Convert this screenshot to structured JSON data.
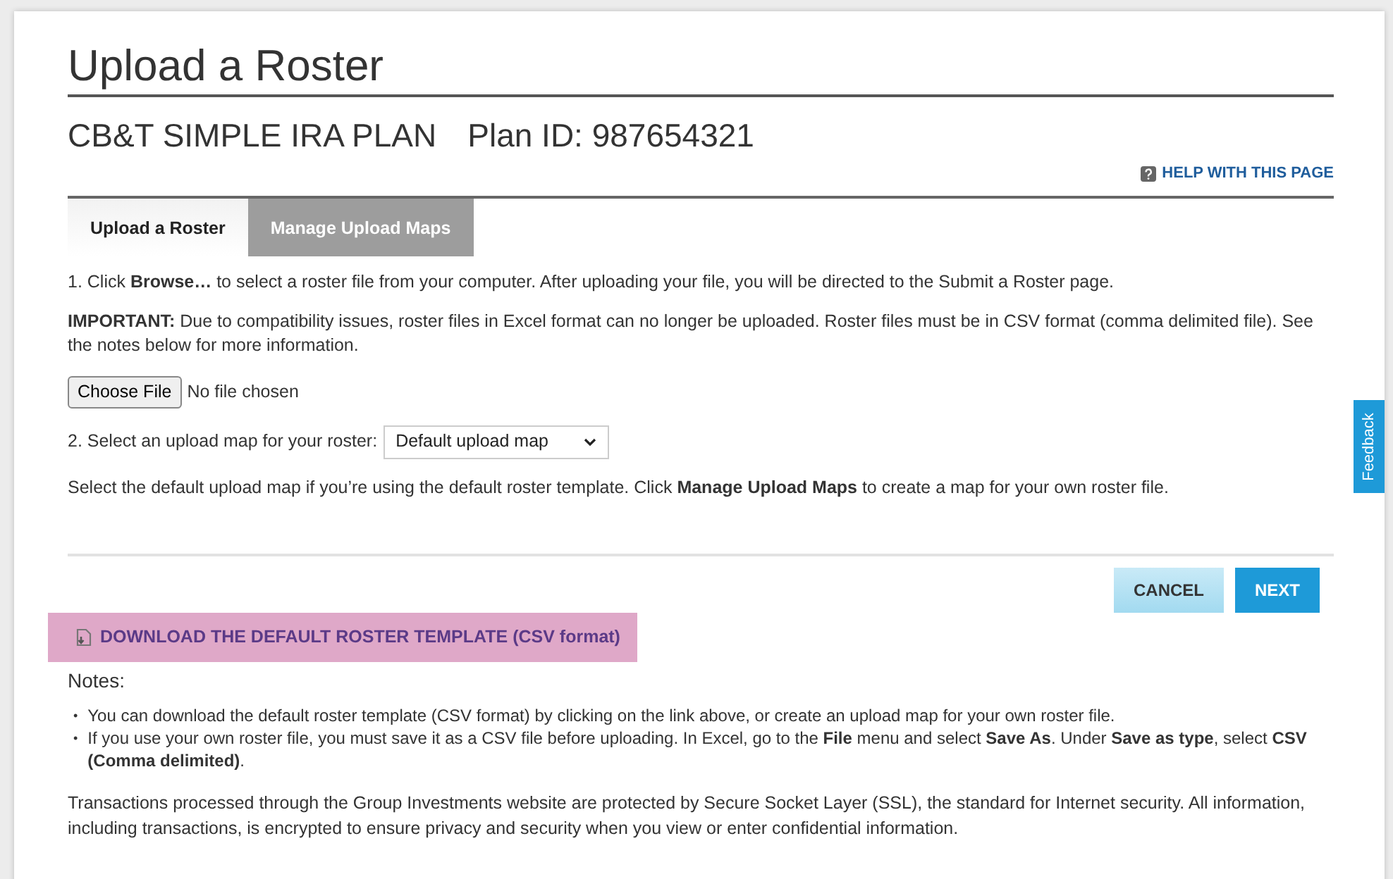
{
  "page_title": "Upload a Roster",
  "plan_name": "CB&T SIMPLE IRA PLAN",
  "plan_id": "Plan ID: 987654321",
  "help_link": "HELP WITH THIS PAGE",
  "tabs": [
    {
      "label": "Upload a Roster",
      "selected": true
    },
    {
      "label": "Manage Upload Maps",
      "selected": false
    }
  ],
  "step_1": "1. Click **Browse…** to select a roster file from your computer. After uploading your file, you will be directed to the Submit a Roster page.",
  "important": "**IMPORTANT:** Due to compatibility issues, roster files in Excel format can no longer be uploaded. Roster files must be in CSV format (comma delimited file). See the notes below for more information.",
  "file_input": {
    "button": "Choose File",
    "status": "No file chosen"
  },
  "step_2": {
    "label": "2. Select an upload map for your roster:",
    "value": "Default upload map"
  },
  "map_hint": "Select the default upload map if you’re using the default roster template. Click **Manage Upload Maps** to create a map for your own roster file.",
  "buttons": [
    {
      "label": "CANCEL",
      "kind": "secondary"
    },
    {
      "label": "NEXT",
      "kind": "primary"
    }
  ],
  "download_link": {
    "label": "DOWNLOAD THE DEFAULT ROSTER TEMPLATE (CSV format)",
    "highlighted": true
  },
  "notes_heading": "Notes:",
  "notes": [
    {
      "bullet": "•",
      "text": "You can download the default roster template (CSV format) by clicking on the link above, or create an upload map for your own roster file."
    },
    {
      "bullet": "•",
      "text": "If you use your own roster file, you must save it as a CSV file before uploading. In Excel, go to the **File** menu and select **Save As**. Under **Save as type**, select **CSV (Comma delimited)**."
    }
  ],
  "security_note": "Transactions processed through the Group Investments website are protected by Secure Socket Layer (SSL), the standard for Internet security. All information, including transactions, is encrypted to ensure privacy and security when you view or enter confidential information.",
  "feedback_tab": "Feedback"
}
